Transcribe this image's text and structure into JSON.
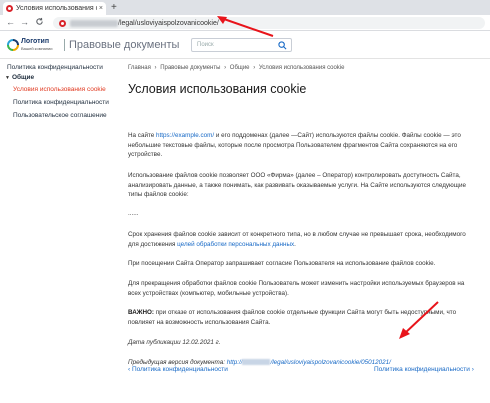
{
  "browser": {
    "tab_title": "Условия использования cookie",
    "tab_close": "×",
    "new_tab": "+",
    "back": "←",
    "forward": "→",
    "reload": "C",
    "url_visible": "/legal/usloviyaispolzovanicookie/"
  },
  "header": {
    "logo_name": "Логотип",
    "logo_sub": "Вашей компании",
    "site_title": "Правовые документы",
    "search_placeholder": "Поиск"
  },
  "sidebar": {
    "items": [
      {
        "label": "Политика конфиденциальности"
      },
      {
        "label": "Общие"
      },
      {
        "label": "Условия использования cookie"
      },
      {
        "label": "Политика конфиденциальности"
      },
      {
        "label": "Пользовательское соглашение"
      }
    ]
  },
  "breadcrumb": {
    "items": [
      "Главная",
      "Правовые документы",
      "Общие",
      "Условия использования cookie"
    ],
    "sep": "›"
  },
  "page": {
    "title": "Условия использования cookie",
    "p1_a": "На сайте ",
    "p1_link": "https://example.com/",
    "p1_b": " и его поддоменах (далее —Сайт) используются файлы cookie. Файлы cookie — это небольшие текстовые файлы, которые после просмотра Пользователем фрагментов Сайта сохраняются на его устройстве.",
    "p2": "Использование файлов cookie позволяет ООО «Фирма» (далее – Оператор) контролировать доступность Сайта, анализировать данные, а также понимать, как развивать оказываемые услуги. На Сайте используются следующие типы файлов cookie:",
    "p3": "......",
    "p4_a": "Срок хранения файлов cookie зависит от конкретного типа, но в любом случае не превышает срока, необходимого для достижения ",
    "p4_link": "целей обработки персональных данных",
    "p4_b": ".",
    "p5": "При посещении Сайта Оператор запрашивает согласие Пользователя на использование файлов cookie.",
    "p6": "Для прекращения обработки файлов cookie Пользователь может изменить настройки используемых браузеров на всех устройствах (компьютер, мобильные устройства).",
    "p7_bold": "ВАЖНО:",
    "p7": " при отказе от использования файлов cookie отдельные функции Сайта могут быть недоступными, что повлияет на возможность использования Сайта.",
    "published": "Дата публикации 12.02.2021 г.",
    "prev_label": "Предыдущая версия документа: ",
    "prev_link_a": "http://",
    "prev_link_b": "/legal/usloviyaispolzovanicookie/05012021/",
    "nav_prev": "Политика конфиденциальности",
    "nav_next": "Политика конфиденциальности",
    "nav_prev_arrow": "‹",
    "nav_next_arrow": "›"
  },
  "colors": {
    "accent_link": "#1769c6",
    "active_item": "#e0381f",
    "annotation_arrow": "#e8141b"
  }
}
